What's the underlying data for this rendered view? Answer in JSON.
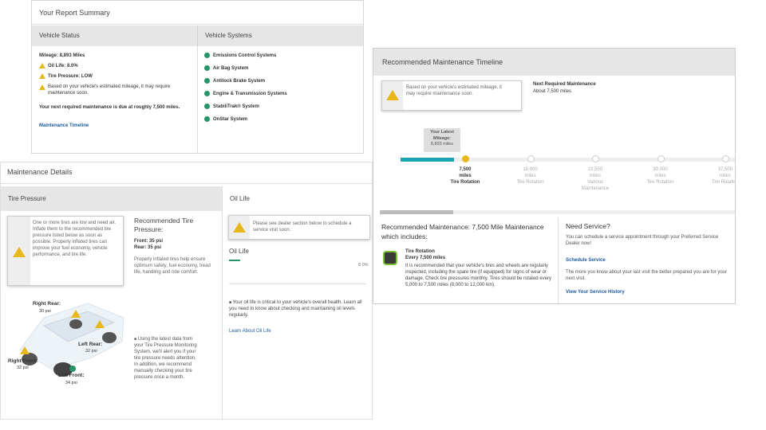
{
  "summary": {
    "title": "Your Report Summary",
    "vehicle_status_header": "Vehicle Status",
    "vehicle_systems_header": "Vehicle Systems",
    "mileage": "Mileage: 8,893 Miles",
    "oil_life": "Oil Life: 8.0%",
    "tire_pressure": "Tire Pressure: LOW",
    "mileage_note": "Based on your vehicle's estimated mileage, it may require maintenance soon.",
    "next_maintenance": "Your next required maintenance is due at roughly 7,500 miles.",
    "timeline_link": "Maintenance Timeline",
    "systems": [
      "Emissions Control Systems",
      "Air Bag System",
      "Antilock Brake System",
      "Engine & Transmission Systems",
      "StabiliTrak® System",
      "OnStar System"
    ]
  },
  "timeline": {
    "title": "Recommended Maintenance Timeline",
    "alert": "Based on your vehicle's estimated mileage, it may require maintenance soon.",
    "next_label": "Next Required Maintenance",
    "next_value": "About 7,500 miles",
    "latest_label": "Your Latest Mileage:",
    "latest_value": "8,893 miles",
    "progress_fraction": 0.16,
    "markers": [
      {
        "miles": "7,500",
        "unit": "miles",
        "service": "Tire Rotation"
      },
      {
        "miles": "15,000",
        "unit": "miles",
        "service": "Tire Rotation"
      },
      {
        "miles": "22,500",
        "unit": "miles",
        "service": "Various Maintenance"
      },
      {
        "miles": "30,000",
        "unit": "miles",
        "service": "Tire Rotation"
      },
      {
        "miles": "37,500",
        "unit": "miles",
        "service": "Tire Rotation"
      }
    ],
    "rec_title": "Recommended Maintenance: 7,500 Mile Maintenance which includes:",
    "rec_item_title": "Tire Rotation",
    "rec_item_sub": "Every 7,500 miles",
    "rec_item_desc": "It is recommended that your vehicle's tires and wheels are regularly inspected, including the spare tire (if equipped) for signs of wear or damage. Check tire pressures monthly. Tires should be rotated every 5,000 to 7,500 miles (8,000 to 12,000 km).",
    "need_title": "Need Service?",
    "need_desc": "You can schedule a service appointment through your Preferred Service Dealer now!",
    "schedule_link": "Schedule Service",
    "history_desc": "The more you know about your last visit the better prepared you are for your next visit.",
    "history_link": "View Your Service History"
  },
  "details": {
    "title": "Maintenance Details",
    "tire_header": "Tire Pressure",
    "oil_header": "Oil Life",
    "tire_alert": "One or more tires are low and need air. Inflate them to the recommended tire pressure listed below as soon as possible. Properly inflated tires can improve your fuel economy, vehicle performance, and tire life.",
    "rec_title": "Recommended Tire Pressure:",
    "front": "Front: 35 psi",
    "rear": "Rear: 35 psi",
    "inflated_note": "Properly inflated tires help ensure optimum safety, fuel economy, tread life, handling and ride comfort.",
    "tpms_note": "Using the latest data from your Tire Pressure Monitoring System, we'll alert you if your tire pressure needs attention. In addition, we recommend manually checking your tire pressure once a month.",
    "right_rear_label": "Right Rear:",
    "right_rear_value": "30 psi",
    "left_rear_label": "Left Rear:",
    "left_rear_value": "32 psi",
    "right_front_label": "Right Front:",
    "right_front_value": "32 psi",
    "left_front_label": "Left Front:",
    "left_front_value": "34 psi",
    "oil_alert": "Please see dealer section below to schedule a service visit soon.",
    "oil_label": "Oil Life",
    "oil_value": "8.0%",
    "oil_fraction": 0.08,
    "oil_note": "Your oil life is critical to your vehicle's overall health. Learn all you need to know about checking and maintaining oil levels regularly.",
    "oil_link": "Learn About Oil Life"
  },
  "colors": {
    "accent": "#1aa3b3",
    "warning": "#e8b71b",
    "ok": "#27946a",
    "link": "#1d5c9e"
  }
}
